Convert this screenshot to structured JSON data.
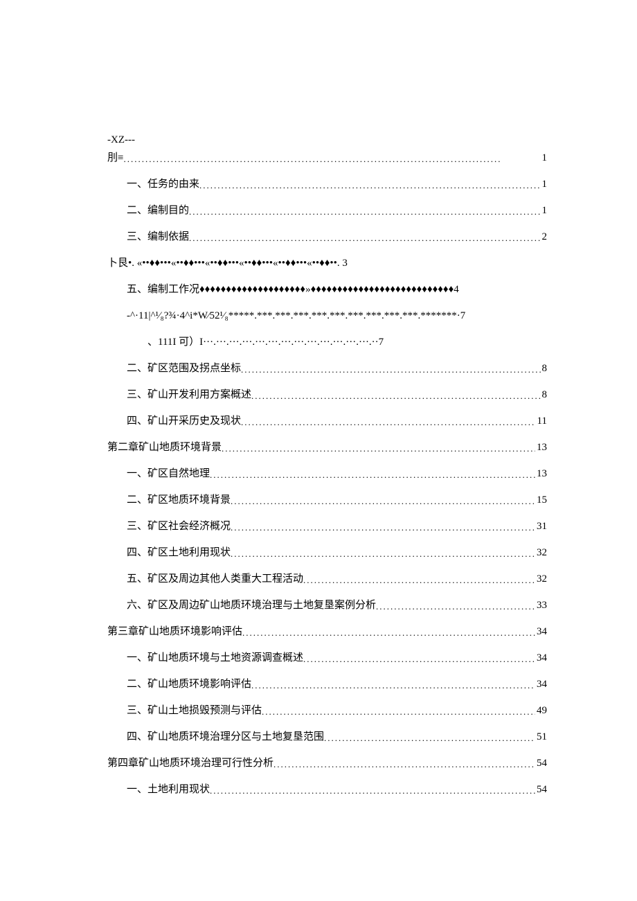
{
  "header": {
    "line1": "-XZ---",
    "line2_label": "刖≡",
    "line2_page": "1"
  },
  "toc": [
    {
      "indent": 1,
      "label": "一、任务的由来",
      "page": "1",
      "leader": "dot"
    },
    {
      "indent": 1,
      "label": "二、编制目的",
      "page": "1",
      "leader": "dot"
    },
    {
      "indent": 1,
      "label": "三、编制依据",
      "page": "2",
      "leader": "dot"
    },
    {
      "indent": 0,
      "label": "卜艮•. «••♦♦•••«••♦♦•••«••♦♦•••«••♦♦•••«••♦♦•••«••♦♦••. 3",
      "page": "",
      "leader": "none"
    },
    {
      "indent": 1,
      "label": "五、编制工作况♦♦♦♦♦♦♦♦♦♦♦♦♦♦♦♦♦♦♦♦»♦♦♦♦♦♦♦♦♦♦♦♦♦♦♦♦♦♦♦♦♦♦♦♦♦♦♦4",
      "page": "",
      "leader": "none"
    },
    {
      "indent": 1,
      "label": "-^·11|^¹⁄₈?¾·4^i*W⁄52¹⁄₈*****.***.***.***.***.***.***.***.***.***.*******·7",
      "page": "",
      "leader": "none"
    },
    {
      "indent": 2,
      "label": "、111I 可）I···.···.···.···.···.···.···.···.···.···.···.···.···.··7",
      "page": "",
      "leader": "none"
    },
    {
      "indent": 1,
      "label": "二、矿区范围及拐点坐标",
      "page": "8",
      "leader": "dot"
    },
    {
      "indent": 1,
      "label": "三、矿山开发利用方案概述",
      "page": "8",
      "leader": "dot"
    },
    {
      "indent": 1,
      "label": "四、矿山开采历史及现状",
      "page": "11",
      "leader": "dot"
    },
    {
      "indent": 0,
      "label": "第二章矿山地质环境背景",
      "page": "13",
      "leader": "dot"
    },
    {
      "indent": 1,
      "label": "一、矿区自然地理",
      "page": "13",
      "leader": "dot"
    },
    {
      "indent": 1,
      "label": "二、矿区地质环境背景",
      "page": "15",
      "leader": "dot"
    },
    {
      "indent": 1,
      "label": "三、矿区社会经济概况",
      "page": "31",
      "leader": "dot"
    },
    {
      "indent": 1,
      "label": "四、矿区土地利用现状",
      "page": "32",
      "leader": "dot"
    },
    {
      "indent": 1,
      "label": "五、矿区及周边其他人类重大工程活动",
      "page": "32",
      "leader": "dot"
    },
    {
      "indent": 1,
      "label": "六、矿区及周边矿山地质环境治理与土地复垦案例分析",
      "page": "33",
      "leader": "dot"
    },
    {
      "indent": 0,
      "label": "第三章矿山地质环境影响评估",
      "page": "34",
      "leader": "dot"
    },
    {
      "indent": 1,
      "label": "一、矿山地质环境与土地资源调查概述",
      "page": "34",
      "leader": "dot"
    },
    {
      "indent": 1,
      "label": "二、矿山地质环境影响评估",
      "page": "34",
      "leader": "dot"
    },
    {
      "indent": 1,
      "label": "三、矿山土地损毁预测与评估",
      "page": "49",
      "leader": "dot"
    },
    {
      "indent": 1,
      "label": "四、矿山地质环境治理分区与土地复垦范围",
      "page": "51",
      "leader": "dot"
    },
    {
      "indent": 0,
      "label": "第四章矿山地质环境治理可行性分析",
      "page": "54",
      "leader": "dot"
    },
    {
      "indent": 1,
      "label": "一、土地利用现状",
      "page": "54",
      "leader": "dot"
    }
  ],
  "leader_dot": "........................................................................................................",
  "leader_space": " "
}
